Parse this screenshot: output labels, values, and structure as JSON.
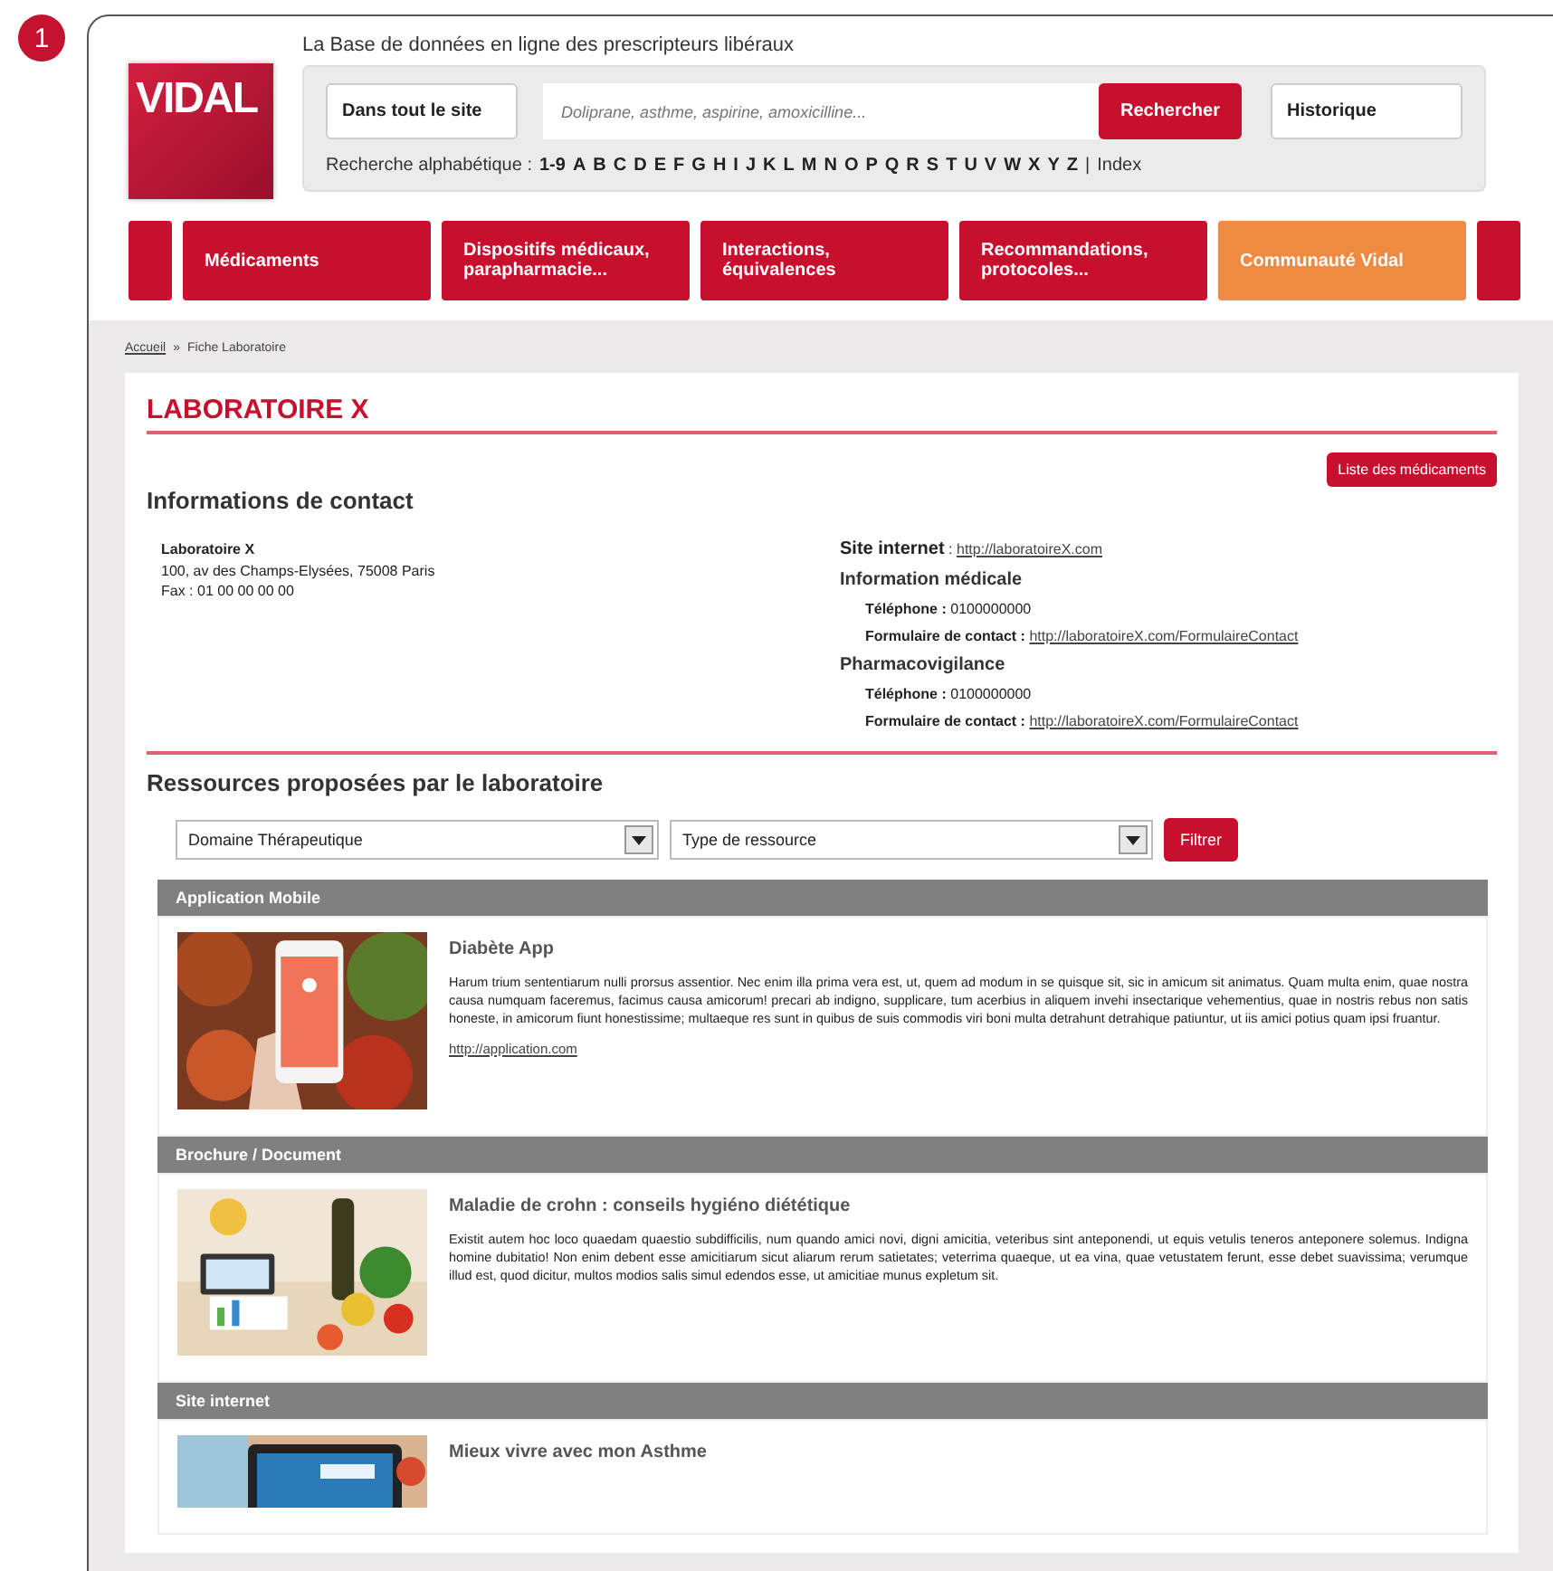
{
  "badge": "1",
  "header": {
    "tagline": "La Base de données en ligne des prescripteurs libéraux",
    "logo": "VIDAL",
    "scope": "Dans tout le site",
    "search_placeholder": "Doliprane, asthme, aspirine, amoxicilline...",
    "search_button": "Rechercher",
    "history_button": "Historique",
    "alpha_label": "Recherche alphabétique :",
    "alphabet": [
      "1-9",
      "A",
      "B",
      "C",
      "D",
      "E",
      "F",
      "G",
      "H",
      "I",
      "J",
      "K",
      "L",
      "M",
      "N",
      "O",
      "P",
      "Q",
      "R",
      "S",
      "T",
      "U",
      "V",
      "W",
      "X",
      "Y",
      "Z"
    ],
    "separator": "|",
    "index": "Index"
  },
  "nav": [
    {
      "kind": "stub",
      "selected": false
    },
    {
      "label": "Médicaments",
      "selected": false
    },
    {
      "label": "Dispositifs médicaux, parapharmacie...",
      "selected": false
    },
    {
      "label": "Interactions, équivalences",
      "selected": false
    },
    {
      "label": "Recommandations, protocoles...",
      "selected": false
    },
    {
      "label": "Communauté Vidal",
      "selected": true
    },
    {
      "kind": "stub",
      "selected": false
    }
  ],
  "breadcrumb": {
    "home": "Accueil",
    "sep": "»",
    "current": "Fiche Laboratoire"
  },
  "title": "LABORATOIRE X",
  "list_button": "Liste des médicaments",
  "contact": {
    "heading": "Informations de contact",
    "name": "Laboratoire X",
    "address": "100, av des Champs-Elysées, 75008 Paris",
    "fax": "Fax : 01 00 00 00 00",
    "site_label": "Site internet",
    "site_sep": ":",
    "site_url": "http://laboratoireX.com",
    "groups": [
      {
        "heading": "Information médicale",
        "phone_label": "Téléphone :",
        "phone": "0100000000",
        "form_label": "Formulaire de contact :",
        "form_url": "http://laboratoireX.com/FormulaireContact"
      },
      {
        "heading": "Pharmacovigilance",
        "phone_label": "Téléphone :",
        "phone": "0100000000",
        "form_label": "Formulaire de contact :",
        "form_url": "http://laboratoireX.com/FormulaireContact"
      }
    ]
  },
  "resources": {
    "heading": "Ressources proposées par le laboratoire",
    "filters": [
      {
        "value": "Domaine Thérapeutique"
      },
      {
        "value": "Type de ressource"
      }
    ],
    "filter_button": "Filtrer",
    "items": [
      {
        "category": "Application Mobile",
        "kind": "app",
        "title": "Diabète App",
        "text": "Harum trium sententiarum nulli prorsus assentior. Nec enim illa prima vera est, ut, quem ad modum in se quisque sit, sic in amicum sit animatus. Quam multa enim, quae nostra causa numquam faceremus, facimus causa amicorum! precari ab indigno, supplicare, tum acerbius in aliquem invehi insectarique vehementius, quae in nostris rebus non satis honeste, in amicorum fiunt honestissime; multaeque res sunt in quibus de suis commodis viri boni multa detrahunt detrahique patiuntur, ut iis amici potius quam ipsi fruantur.",
        "link": "http://application.com"
      },
      {
        "category": "Brochure / Document",
        "kind": "food",
        "title": "Maladie de crohn : conseils hygiéno diététique",
        "text": "Existit autem hoc loco quaedam quaestio subdifficilis, num quando amici novi, digni amicitia, veteribus sint anteponendi, ut equis vetulis teneros anteponere solemus. Indigna homine dubitatio! Non enim debent esse amicitiarum sicut aliarum rerum satietates; veterrima quaeque, ut ea vina, quae vetustatem ferunt, esse debet suavissima; verumque illud est, quod dicitur, multos modios salis simul edendos esse, ut amicitiae munus expletum sit."
      },
      {
        "category": "Site internet",
        "kind": "tablet",
        "title": "Mieux vivre avec mon Asthme"
      }
    ]
  }
}
